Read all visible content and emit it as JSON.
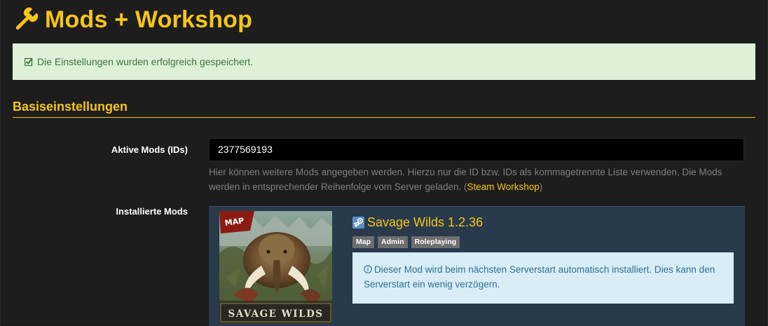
{
  "page": {
    "title": "Mods + Workshop",
    "title_icon": "wrench-icon",
    "accent_color": "#f5c518"
  },
  "success_alert": {
    "icon": "check-square-icon",
    "text": "Die Einstellungen wurden erfolgreich gespeichert."
  },
  "basic_settings": {
    "heading": "Basiseinstellungen",
    "active_mods": {
      "label": "Aktive Mods (IDs)",
      "value": "2377569193",
      "help_before": "Hier können weitere Mods angegeben werden. Hierzu nur die ID bzw. IDs als kommagetrennte Liste verwenden. Die Mods werden in entsprechender Reihenfolge vom Server geladen. (",
      "help_link": "Steam Workshop",
      "help_after": ")"
    },
    "installed_mods": {
      "label": "Installierte Mods",
      "mods": [
        {
          "title": "Savage Wilds 1.2.36",
          "title_icon": "steam-icon",
          "thumbnail_badge": "MAP",
          "thumbnail_caption": "SAVAGE WILDS",
          "tags": [
            "Map",
            "Admin",
            "Roleplaying"
          ],
          "info_icon": "info-circle-icon",
          "info_text": "Dieser Mod wird beim nächsten Serverstart automatisch installiert. Dies kann den Serverstart ein wenig verzögern."
        }
      ]
    }
  }
}
